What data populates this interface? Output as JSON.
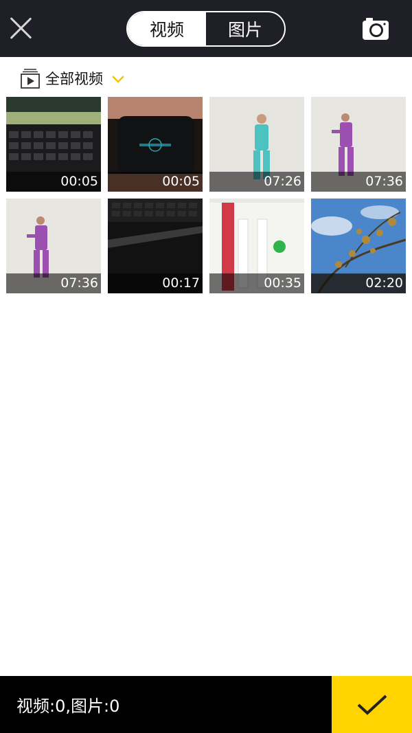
{
  "header": {
    "tabs": [
      {
        "label": "视频",
        "active": true
      },
      {
        "label": "图片",
        "active": false
      }
    ],
    "close_icon": "close-icon",
    "camera_icon": "camera-icon"
  },
  "album": {
    "label": "全部视频",
    "icon": "video-album-icon",
    "chevron": "chevron-down-icon",
    "chevron_color": "#f5c400"
  },
  "media": [
    {
      "duration": "00:05",
      "thumb": "laptop-keyboard"
    },
    {
      "duration": "00:05",
      "thumb": "phone-in-hand"
    },
    {
      "duration": "07:26",
      "thumb": "person-teal-outfit"
    },
    {
      "duration": "07:36",
      "thumb": "person-purple-outfit"
    },
    {
      "duration": "07:36",
      "thumb": "person-purple-outfit"
    },
    {
      "duration": "00:17",
      "thumb": "dark-keyboard"
    },
    {
      "duration": "00:35",
      "thumb": "app-screen"
    },
    {
      "duration": "02:20",
      "thumb": "tree-sky"
    }
  ],
  "footer": {
    "counter": "视频:0,图片:0",
    "confirm_icon": "checkmark-icon",
    "accent": "#ffd400"
  }
}
